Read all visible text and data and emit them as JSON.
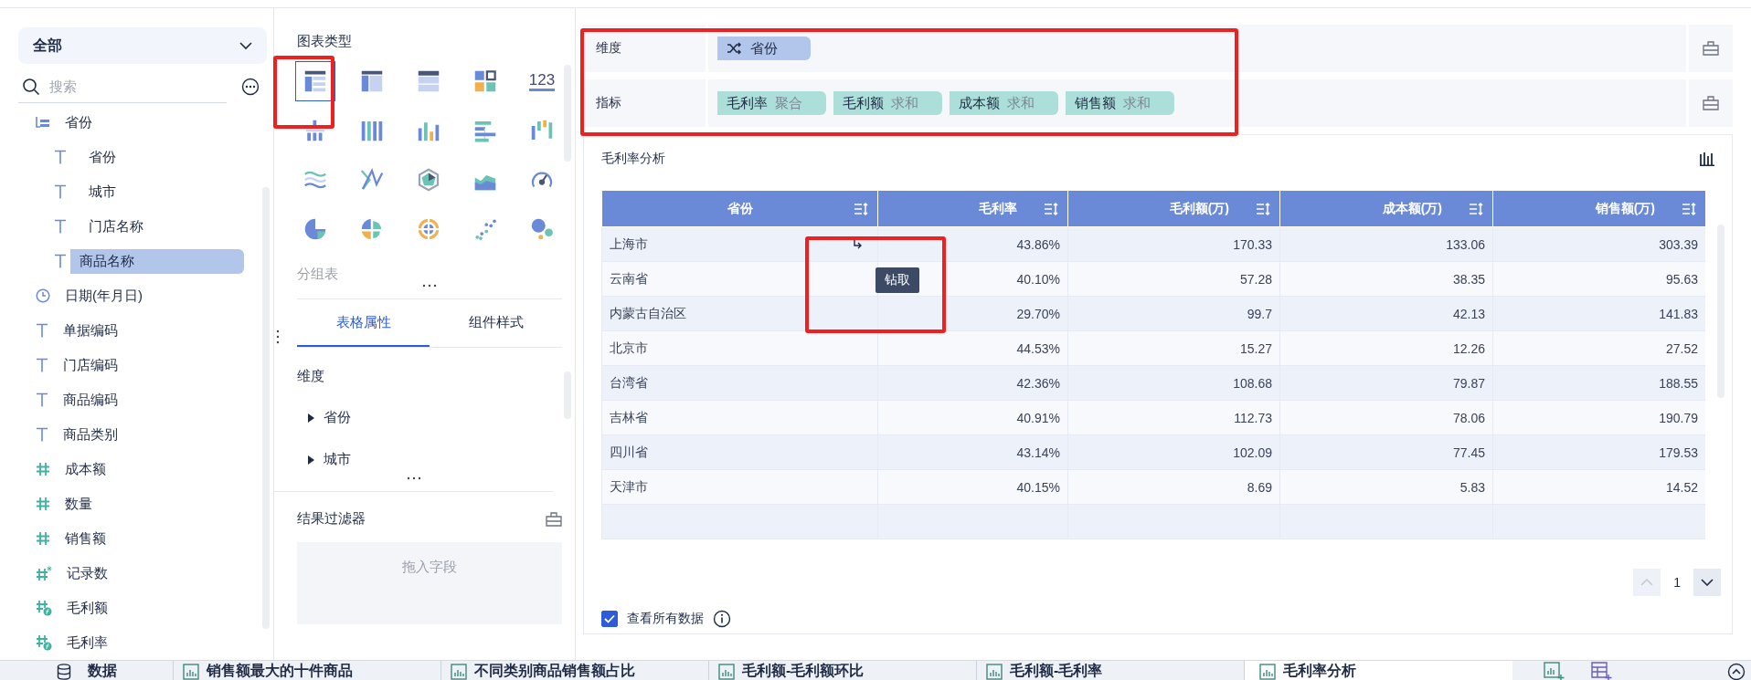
{
  "field_filter": {
    "value": "全部"
  },
  "search": {
    "placeholder": "搜索"
  },
  "fields": [
    {
      "kind": "group",
      "label": "省份",
      "selected": false,
      "children": [
        {
          "kind": "text",
          "label": "省份",
          "selected": false
        },
        {
          "kind": "text",
          "label": "城市",
          "selected": false
        },
        {
          "kind": "text",
          "label": "门店名称",
          "selected": false
        },
        {
          "kind": "text",
          "label": "商品名称",
          "selected": true
        }
      ]
    },
    {
      "kind": "date",
      "label": "日期(年月日)",
      "selected": false
    },
    {
      "kind": "text",
      "label": "单据编码",
      "selected": false
    },
    {
      "kind": "text",
      "label": "门店编码",
      "selected": false
    },
    {
      "kind": "text",
      "label": "商品编码",
      "selected": false
    },
    {
      "kind": "text",
      "label": "商品类别",
      "selected": false
    },
    {
      "kind": "number",
      "label": "成本额",
      "selected": false
    },
    {
      "kind": "number",
      "label": "数量",
      "selected": false
    },
    {
      "kind": "number",
      "label": "销售额",
      "selected": false
    },
    {
      "kind": "count",
      "label": "记录数",
      "selected": false
    },
    {
      "kind": "calc",
      "label": "毛利额",
      "selected": false
    },
    {
      "kind": "calc",
      "label": "毛利率",
      "selected": false
    }
  ],
  "chart_types": {
    "title": "图表类型",
    "items": [
      {
        "kind": "group-table",
        "selected": true
      },
      {
        "kind": "cross-table",
        "selected": false
      },
      {
        "kind": "detail-table",
        "selected": false
      },
      {
        "kind": "dashboard",
        "selected": false
      },
      {
        "kind": "kpi",
        "glyph": "123",
        "selected": false
      },
      {
        "kind": "stacked",
        "selected": false
      },
      {
        "kind": "multi-column",
        "selected": false
      },
      {
        "kind": "column",
        "selected": false
      },
      {
        "kind": "bar",
        "selected": false
      },
      {
        "kind": "waterfall",
        "selected": false
      },
      {
        "kind": "wave",
        "selected": false
      },
      {
        "kind": "line",
        "selected": false
      },
      {
        "kind": "radar",
        "selected": false
      },
      {
        "kind": "area",
        "selected": false
      },
      {
        "kind": "gauge",
        "selected": false
      },
      {
        "kind": "pie",
        "selected": false
      },
      {
        "kind": "rose",
        "selected": false
      },
      {
        "kind": "sunburst",
        "selected": false
      },
      {
        "kind": "scatter",
        "selected": false
      },
      {
        "kind": "bubble",
        "selected": false
      }
    ],
    "current": "分组表"
  },
  "property_tabs": [
    {
      "label": "表格属性",
      "selected": true
    },
    {
      "label": "组件样式",
      "selected": false
    }
  ],
  "dimension_section": {
    "title": "维度",
    "items": [
      "省份",
      "城市"
    ]
  },
  "result_filter": {
    "title": "结果过滤器",
    "hint": "拖入字段"
  },
  "dimensions": {
    "label": "维度",
    "pills": [
      {
        "name": "省份"
      }
    ]
  },
  "measures": {
    "label": "指标",
    "pills": [
      {
        "name": "毛利率",
        "agg": "聚合"
      },
      {
        "name": "毛利额",
        "agg": "求和"
      },
      {
        "name": "成本额",
        "agg": "求和"
      },
      {
        "name": "销售额",
        "agg": "求和"
      }
    ]
  },
  "widget": {
    "title": "毛利率分析",
    "table": {
      "columns": [
        "省份",
        "毛利率",
        "毛利额(万)",
        "成本额(万)",
        "销售额(万)"
      ],
      "rows": [
        [
          "上海市",
          "43.86%",
          "170.33",
          "133.06",
          "303.39"
        ],
        [
          "云南省",
          "40.10%",
          "57.28",
          "38.35",
          "95.63"
        ],
        [
          "内蒙古自治区",
          "29.70%",
          "99.7",
          "42.13",
          "141.83"
        ],
        [
          "北京市",
          "44.53%",
          "15.27",
          "12.26",
          "27.52"
        ],
        [
          "台湾省",
          "42.36%",
          "108.68",
          "79.87",
          "188.55"
        ],
        [
          "吉林省",
          "40.91%",
          "112.73",
          "78.06",
          "190.79"
        ],
        [
          "四川省",
          "43.14%",
          "102.09",
          "77.45",
          "179.53"
        ],
        [
          "天津市",
          "40.15%",
          "8.69",
          "5.83",
          "14.52"
        ]
      ]
    },
    "tooltip": "钻取",
    "pagination": {
      "page": "1",
      "prev_disabled": true
    },
    "show_all": {
      "label": "查看所有数据",
      "checked": true
    }
  },
  "bottom_tabs": {
    "data_tab": "数据",
    "tabs": [
      {
        "label": "销售额最大的十件商品",
        "selected": false
      },
      {
        "label": "不同类别商品销售额占比",
        "selected": false
      },
      {
        "label": "毛利额-毛利额环比",
        "selected": false
      },
      {
        "label": "毛利额-毛利率",
        "selected": false
      },
      {
        "label": "毛利率分析",
        "selected": true
      }
    ]
  }
}
